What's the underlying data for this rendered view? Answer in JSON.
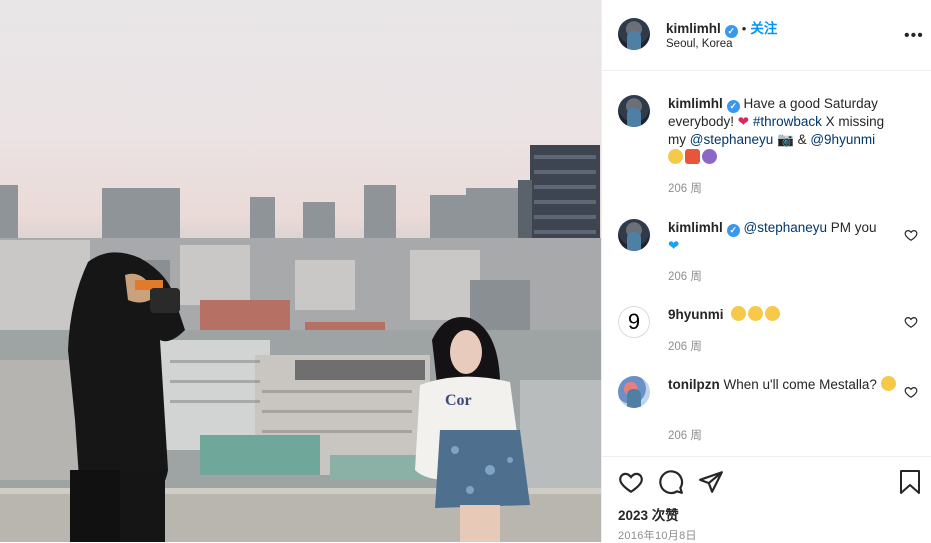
{
  "post": {
    "username": "kimlimhl",
    "verified_mark": "✓",
    "separator": "•",
    "follow_label": "关注",
    "location": "Seoul, Korea",
    "more_label": "•••"
  },
  "caption": {
    "username": "kimlimhl",
    "text_1": "Have a good Saturday everybody! ",
    "hashtag": "#throwback",
    "text_2": " X missing my ",
    "mention_1": "@stephaneyu",
    "text_3": " 📷 & ",
    "mention_2": "@9hyunmi",
    "time": "206 周"
  },
  "comments": [
    {
      "username": "kimlimhl",
      "mention": "@stephaneyu",
      "text": " PM you",
      "time": "206 周"
    },
    {
      "username": "9hyunmi",
      "avatar_text": "9",
      "time": "206 周"
    },
    {
      "username": "tonilpzn",
      "text": "When u'll come Mestalla? ",
      "time": "206 周"
    }
  ],
  "footer": {
    "likes": "2023 次赞",
    "date": "2016年10月8日"
  },
  "icons": {
    "heart": "heart-icon",
    "comment": "comment-icon",
    "share": "share-icon",
    "save": "bookmark-icon"
  },
  "colors": {
    "link": "#00376b",
    "follow": "#0095f6",
    "verified": "#3897f0"
  }
}
